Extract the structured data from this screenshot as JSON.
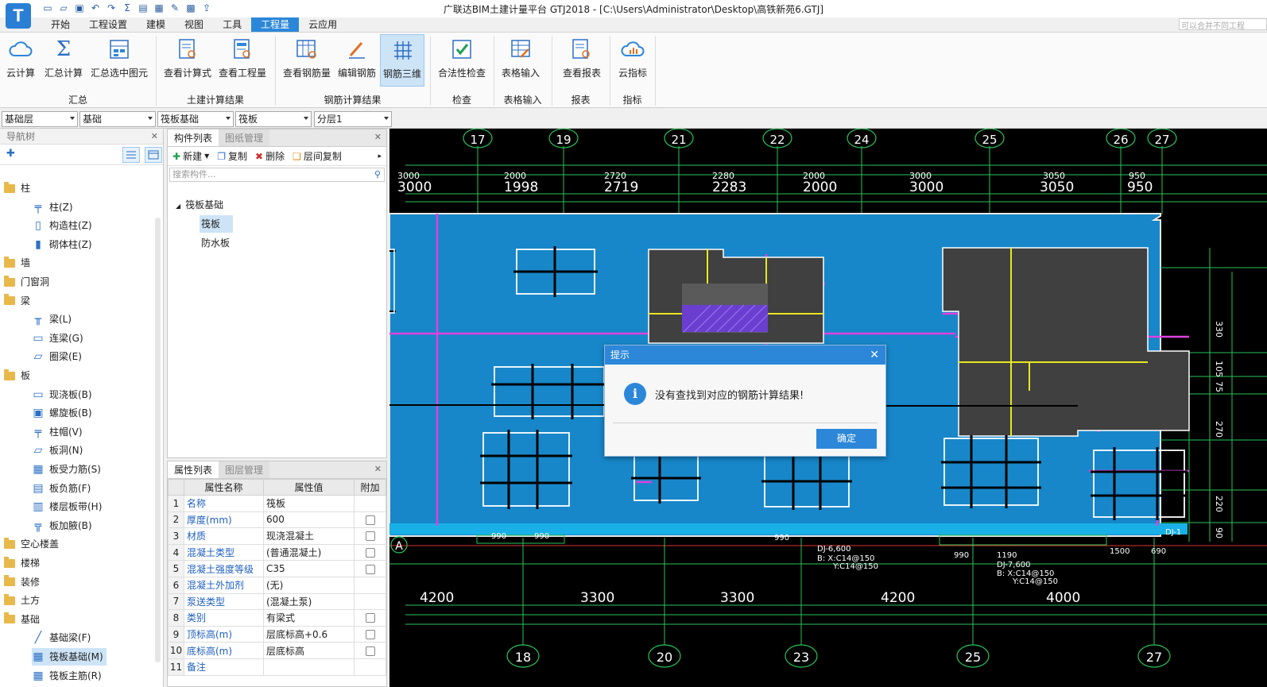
{
  "window": {
    "title": "广联达BIM土建计量平台 GTJ2018 - [C:\\Users\\Administrator\\Desktop\\高铁新苑6.GTJ]",
    "logo": "T",
    "search_placeholder": "可以合并不同工程"
  },
  "menu": [
    "开始",
    "工程设置",
    "建模",
    "视图",
    "工具",
    "工程量",
    "云应用"
  ],
  "ribbon": {
    "buttons": [
      "云计算",
      "汇总计算",
      "汇总选中图元",
      "查看计算式",
      "查看工程量",
      "查看钢筋量",
      "编辑钢筋",
      "钢筋三维",
      "合法性检查",
      "表格输入",
      "查看报表",
      "云指标"
    ],
    "groups": [
      "汇总",
      "土建计算结果",
      "钢筋计算结果",
      "检查",
      "表格输入",
      "报表",
      "指标"
    ]
  },
  "selectors": [
    "基础层",
    "基础",
    "筏板基础",
    "筏板",
    "分层1"
  ],
  "navtree": {
    "title": "导航树",
    "items": [
      {
        "label": "柱",
        "icon": "folder-icon"
      },
      {
        "label": "柱(Z)",
        "icon": "column-icon"
      },
      {
        "label": "构造柱(Z)",
        "icon": "construction-column-icon"
      },
      {
        "label": "砌体柱(Z)",
        "icon": "masonry-column-icon"
      },
      {
        "label": "墙",
        "icon": "folder-icon"
      },
      {
        "label": "门窗洞",
        "icon": "folder-icon"
      },
      {
        "label": "梁",
        "icon": "folder-icon"
      },
      {
        "label": "梁(L)",
        "icon": "beam-icon"
      },
      {
        "label": "连梁(G)",
        "icon": "link-beam-icon"
      },
      {
        "label": "圈梁(E)",
        "icon": "ring-beam-icon"
      },
      {
        "label": "板",
        "icon": "folder-icon"
      },
      {
        "label": "现浇板(B)",
        "icon": "slab-icon"
      },
      {
        "label": "螺旋板(B)",
        "icon": "spiral-slab-icon"
      },
      {
        "label": "柱帽(V)",
        "icon": "column-cap-icon"
      },
      {
        "label": "板洞(N)",
        "icon": "slab-hole-icon"
      },
      {
        "label": "板受力筋(S)",
        "icon": "slab-rebar-icon"
      },
      {
        "label": "板负筋(F)",
        "icon": "slab-neg-rebar-icon"
      },
      {
        "label": "楼层板带(H)",
        "icon": "slab-strip-icon"
      },
      {
        "label": "板加腋(B)",
        "icon": "slab-haunch-icon"
      },
      {
        "label": "空心楼盖",
        "icon": "folder-icon"
      },
      {
        "label": "楼梯",
        "icon": "folder-icon"
      },
      {
        "label": "装修",
        "icon": "folder-icon"
      },
      {
        "label": "土方",
        "icon": "folder-icon"
      },
      {
        "label": "基础",
        "icon": "folder-icon"
      },
      {
        "label": "基础梁(F)",
        "icon": "foundation-beam-icon"
      },
      {
        "label": "筏板基础(M)",
        "icon": "raft-foundation-icon"
      },
      {
        "label": "筏板主筋(R)",
        "icon": "raft-rebar-icon"
      }
    ]
  },
  "complist": {
    "tabs": [
      "构件列表",
      "图纸管理"
    ],
    "tools": [
      "新建",
      "复制",
      "删除",
      "层间复制"
    ],
    "search_placeholder": "搜索构件...",
    "tree_root": "筏板基础",
    "tree_items": [
      "筏板",
      "防水板"
    ]
  },
  "proplist": {
    "tabs": [
      "属性列表",
      "图层管理"
    ],
    "headers": [
      "属性名称",
      "属性值",
      "附加"
    ],
    "rows": [
      {
        "n": "1",
        "name": "名称",
        "value": "筏板",
        "check": false
      },
      {
        "n": "2",
        "name": "厚度(mm)",
        "value": "600",
        "check": true
      },
      {
        "n": "3",
        "name": "材质",
        "value": "现浇混凝土",
        "check": true
      },
      {
        "n": "4",
        "name": "混凝土类型",
        "value": "(普通混凝土)",
        "check": true
      },
      {
        "n": "5",
        "name": "混凝土强度等级",
        "value": "C35",
        "check": true
      },
      {
        "n": "6",
        "name": "混凝土外加剂",
        "value": "(无)",
        "check": false
      },
      {
        "n": "7",
        "name": "泵送类型",
        "value": "(混凝土泵)",
        "check": false
      },
      {
        "n": "8",
        "name": "类别",
        "value": "有梁式",
        "check": true
      },
      {
        "n": "9",
        "name": "顶标高(m)",
        "value": "层底标高+0.6",
        "check": true
      },
      {
        "n": "10",
        "name": "底标高(m)",
        "value": "层底标高",
        "check": true
      },
      {
        "n": "11",
        "name": "备注",
        "value": "",
        "check": false
      }
    ]
  },
  "cad": {
    "top_axes": [
      "17",
      "19",
      "21",
      "22",
      "24",
      "25",
      "26",
      "27"
    ],
    "top_dims_small": [
      "3000",
      "2000",
      "2720",
      "2280",
      "2000",
      "3000",
      "3050",
      "950"
    ],
    "top_dims_big": [
      "3000",
      "1998",
      "2719",
      "2283",
      "2000",
      "3000",
      "3050",
      "950"
    ],
    "bottom_axes": [
      "18",
      "20",
      "23",
      "25",
      "27"
    ],
    "bottom_dims": [
      "4200",
      "3300",
      "3300",
      "4200",
      "4000"
    ],
    "right_dims": [
      "330",
      "105",
      "75",
      "270",
      "220",
      "90"
    ],
    "labels": [
      "A",
      "990",
      "990",
      "990",
      "DJ-6,600",
      "B: X:C14@150",
      "Y:C14@150",
      "990",
      "1190",
      "DJ-7,600",
      "B: X:C14@150",
      "Y:C14@150",
      "1500",
      "690",
      "DJ-1"
    ]
  },
  "dialog": {
    "title": "提示",
    "message": "没有查找到对应的钢筋计算结果!",
    "ok": "确定"
  }
}
